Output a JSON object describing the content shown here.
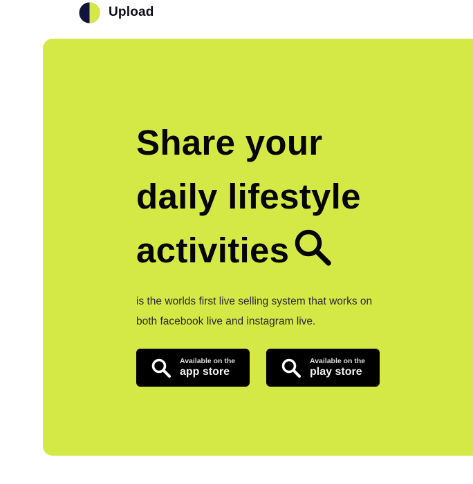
{
  "colors": {
    "accent": "#d5e946",
    "dark": "#12133d",
    "button_bg": "#000000",
    "text": "#050505"
  },
  "brand": {
    "name": "Upload",
    "logo_icon": "half-circle-logo"
  },
  "hero": {
    "title_lines": [
      "Share your",
      "daily lifestyle",
      "activities"
    ],
    "title_icon": "search-icon",
    "description": "is the worlds first live selling system that works on both facebook live and instagram live.",
    "buttons": [
      {
        "icon": "search-icon",
        "small_label": "Available on the",
        "big_label": "app store"
      },
      {
        "icon": "search-icon",
        "small_label": "Available on the",
        "big_label": "play store"
      }
    ]
  }
}
